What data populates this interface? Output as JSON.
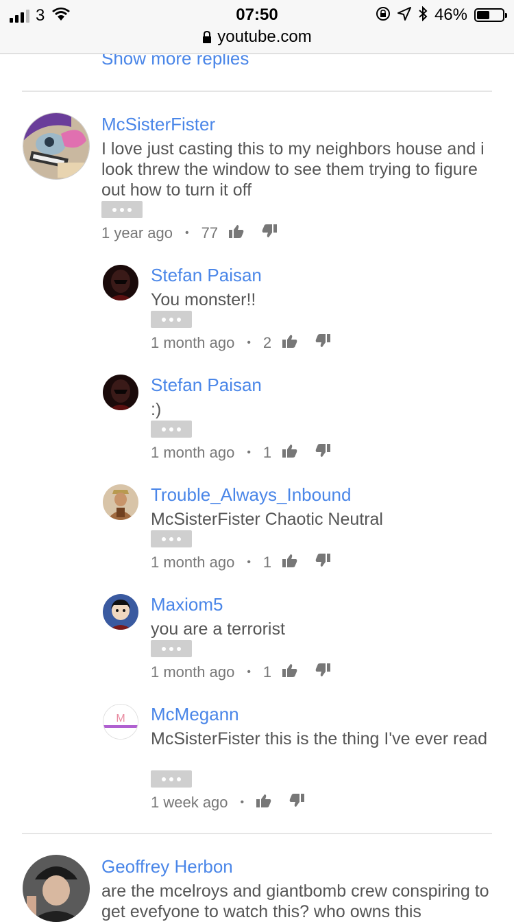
{
  "status_bar": {
    "carrier": "3",
    "time": "07:50",
    "url": "youtube.com",
    "battery": "46%"
  },
  "show_more_replies": "Show more replies",
  "comment": {
    "author": "McSisterFister",
    "text": "I love just casting this to my neighbors house and i look threw the window to see them trying to figure out how to turn it off",
    "time": "1 year ago",
    "likes": "77"
  },
  "replies": [
    {
      "author": "Stefan Paisan",
      "text": "You monster!!",
      "time": "1 month ago",
      "likes": "2"
    },
    {
      "author": "Stefan Paisan",
      "text": ":)",
      "time": "1 month ago",
      "likes": "1"
    },
    {
      "author": "Trouble_Always_Inbound",
      "text": "McSisterFister Chaotic Neutral",
      "time": "1 month ago",
      "likes": "1"
    },
    {
      "author": "Maxiom5",
      "text": "you are a terrorist",
      "time": "1 month ago",
      "likes": "1"
    },
    {
      "author": "McMegann",
      "text": "McSisterFister this is the thing I've ever read",
      "time": "1 week ago",
      "likes": ""
    }
  ],
  "next_comment": {
    "author": "Geoffrey Herbon",
    "text": "are the mcelroys and giantbomb crew conspiring to get evefyone to watch this? who owns this"
  },
  "avatar_letters": {
    "mcmegann": "M"
  },
  "colors": {
    "link": "#4a86e8",
    "text": "#555555",
    "meta": "#777777",
    "divider": "#e5e5e5"
  }
}
